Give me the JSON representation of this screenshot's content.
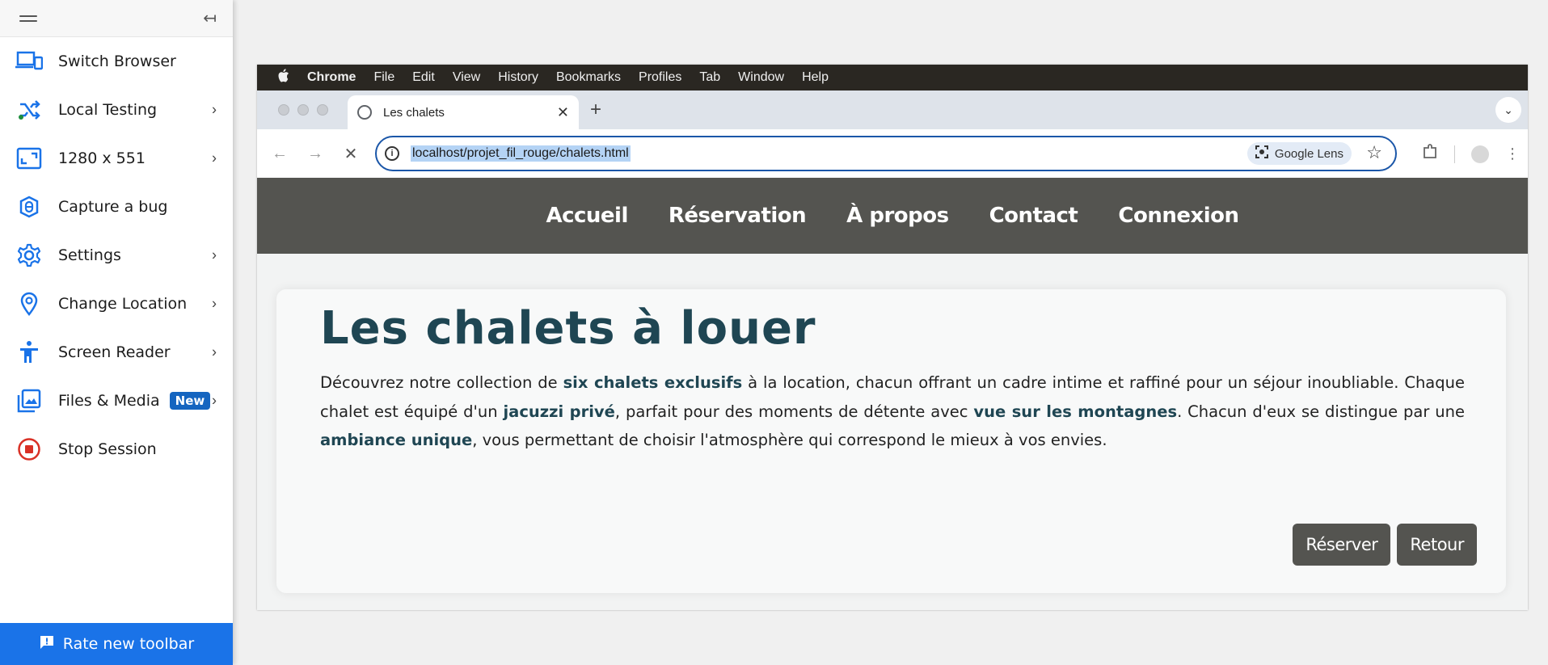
{
  "toolbar": {
    "items": [
      {
        "label": "Switch Browser"
      },
      {
        "label": "Local Testing"
      },
      {
        "label": "1280 x 551"
      },
      {
        "label": "Capture a bug"
      },
      {
        "label": "Settings"
      },
      {
        "label": "Change Location"
      },
      {
        "label": "Screen Reader"
      },
      {
        "label": "Files & Media",
        "badge": "New"
      },
      {
        "label": "Stop Session"
      }
    ],
    "rate_label": "Rate new toolbar"
  },
  "mac_menu": [
    "Chrome",
    "File",
    "Edit",
    "View",
    "History",
    "Bookmarks",
    "Profiles",
    "Tab",
    "Window",
    "Help"
  ],
  "browser": {
    "tab_title": "Les chalets",
    "url": "localhost/projet_fil_rouge/chalets.html",
    "lens_label": "Google Lens"
  },
  "site": {
    "nav": [
      "Accueil",
      "Réservation",
      "À propos",
      "Contact",
      "Connexion"
    ],
    "heading": "Les chalets à louer",
    "para": {
      "t1": "Découvrez notre collection de ",
      "b1": "six chalets exclusifs",
      "t2": " à la location, chacun offrant un cadre intime et raffiné pour un séjour inoubliable. Chaque chalet est équipé d'un ",
      "b2": "jacuzzi privé",
      "t3": ", parfait pour des moments de détente avec ",
      "b3": "vue sur les montagnes",
      "t4": ". Chacun d'eux se distingue par une ",
      "b4": "ambiance unique",
      "t5": ", vous permettant de choisir l'atmosphère qui correspond le mieux à vos envies."
    },
    "buttons": {
      "reserve": "Réserver",
      "back": "Retour"
    }
  }
}
